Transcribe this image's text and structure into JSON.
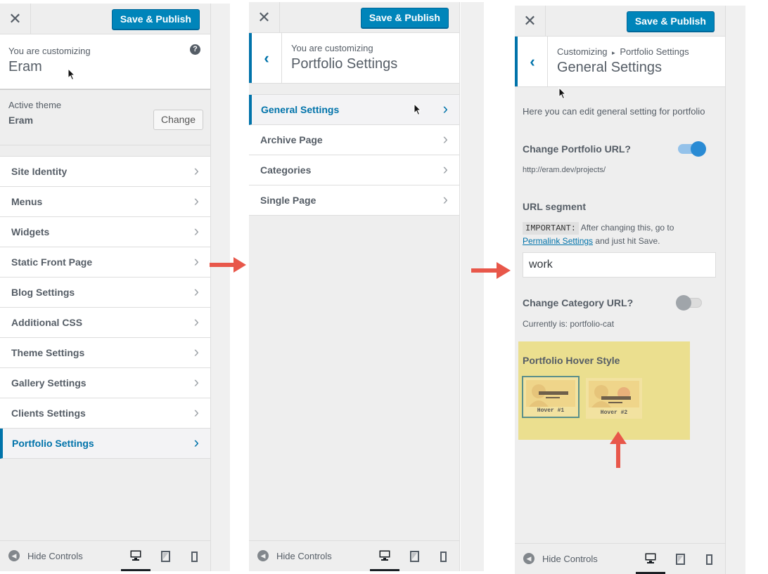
{
  "common": {
    "save_label": "Save & Publish",
    "close_glyph": "✕",
    "hide_controls": "Hide Controls",
    "chevron": "›",
    "back_glyph": "‹"
  },
  "panel1": {
    "you_are_customizing": "You are customizing",
    "site_name": "Eram",
    "help_glyph": "?",
    "active_theme_label": "Active theme",
    "theme_name": "Eram",
    "change_label": "Change",
    "menu": [
      {
        "label": "Site Identity"
      },
      {
        "label": "Menus"
      },
      {
        "label": "Widgets"
      },
      {
        "label": "Static Front Page"
      },
      {
        "label": "Blog Settings"
      },
      {
        "label": "Additional CSS"
      },
      {
        "label": "Theme Settings"
      },
      {
        "label": "Gallery Settings"
      },
      {
        "label": "Clients Settings"
      },
      {
        "label": "Portfolio Settings",
        "active": true
      }
    ]
  },
  "panel2": {
    "you_are_customizing": "You are customizing",
    "section_title": "Portfolio Settings",
    "menu": [
      {
        "label": "General Settings",
        "active": true
      },
      {
        "label": "Archive Page"
      },
      {
        "label": "Categories"
      },
      {
        "label": "Single Page"
      }
    ]
  },
  "panel3": {
    "crumb_root": "Customizing",
    "crumb_sep": "▸",
    "crumb_parent": "Portfolio Settings",
    "section_title": "General Settings",
    "description": "Here you can edit general setting for portfolio",
    "portfolio_url_label": "Change Portfolio URL?",
    "portfolio_url_on": true,
    "portfolio_url_value": "http://eram.dev/projects/",
    "url_segment_label": "URL segment",
    "important_tag": "IMPORTANT:",
    "important_text_1": "After changing this, go to",
    "permalink_link": "Permalink Settings",
    "important_text_2": "and just hit Save.",
    "url_segment_value": "work",
    "category_url_label": "Change Category URL?",
    "category_url_on": false,
    "category_current": "Currently is: portfolio-cat",
    "hover_style_label": "Portfolio Hover Style",
    "hover_options": [
      {
        "caption": "Hover #1",
        "selected": true
      },
      {
        "caption": "Hover #2",
        "selected": false
      }
    ]
  },
  "colors": {
    "accent": "#0073aa",
    "save_button": "#0085ba",
    "toggle_on": "#2a8bd4",
    "toggle_off": "#a0a5aa",
    "highlight": "#ebdf8f",
    "arrow_red": "#e8574a"
  },
  "icons": {
    "close": "close-icon",
    "help": "help-icon",
    "chevron": "chevron-right-icon",
    "back": "chevron-left-icon",
    "hide_controls": "arrow-left-circle-icon",
    "desktop": "desktop-icon",
    "tablet": "tablet-icon",
    "mobile": "mobile-icon",
    "annotation_arrow": "red-arrow-icon"
  }
}
